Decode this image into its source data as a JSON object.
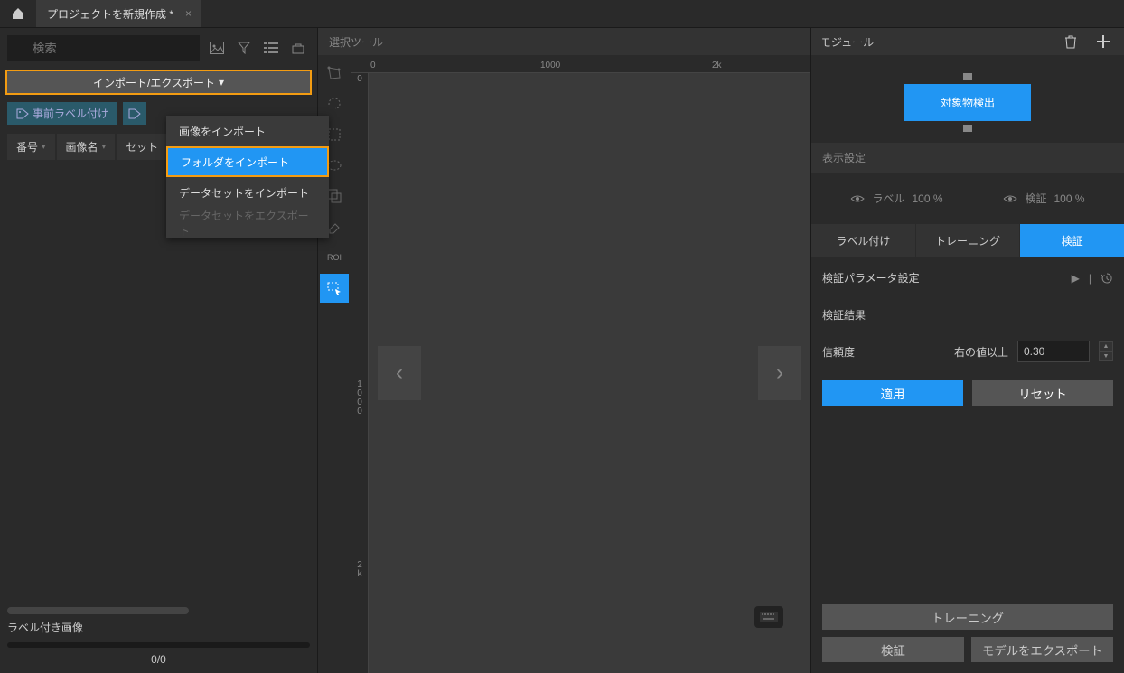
{
  "titlebar": {
    "tab_title": "プロジェクトを新規作成 *"
  },
  "left": {
    "search_placeholder": "検索",
    "import_export": "インポート/エクスポート",
    "dropdown": {
      "import_image": "画像をインポート",
      "import_folder": "フォルダをインポート",
      "import_dataset": "データセットをインポート",
      "export_dataset": "データセットをエクスポート"
    },
    "prelabel": "事前ラベル付け",
    "columns": {
      "number": "番号",
      "image_name": "画像名",
      "set": "セット"
    },
    "labeled_images": "ラベル付き画像",
    "progress": "0/0"
  },
  "center": {
    "tool_label": "選択ツール",
    "ruler": {
      "t0": "0",
      "t1000": "1000",
      "t2k": "2k",
      "v0": "0",
      "v1000a": "1",
      "v1000b": "0",
      "v1000c": "0",
      "v1000d": "0",
      "v2ka": "2",
      "v2kb": "k"
    },
    "roi": "ROI"
  },
  "right": {
    "module": "モジュール",
    "detect": "対象物検出",
    "display_settings": "表示設定",
    "vis_label": "ラベル",
    "vis_label_pct": "100 %",
    "vis_verify": "検証",
    "vis_verify_pct": "100 %",
    "tabs": {
      "labeling": "ラベル付け",
      "training": "トレーニング",
      "verify": "検証"
    },
    "param_settings": "検証パラメータ設定",
    "verify_result": "検証結果",
    "confidence": "信頼度",
    "gte": "右の値以上",
    "confidence_val": "0.30",
    "apply": "適用",
    "reset": "リセット",
    "training_btn": "トレーニング",
    "verify_btn": "検証",
    "export_model": "モデルをエクスポート"
  }
}
